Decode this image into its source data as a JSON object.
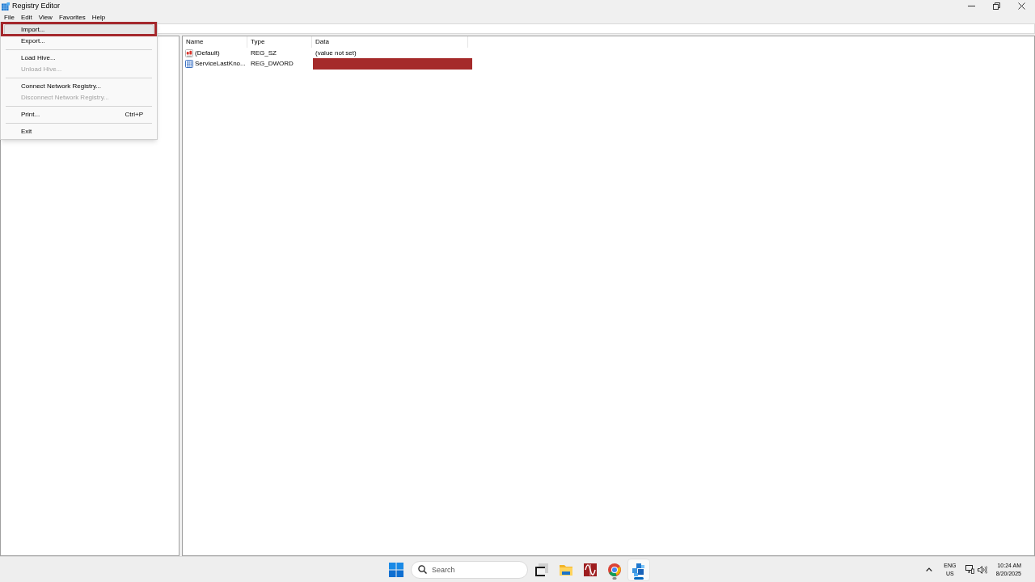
{
  "window": {
    "title": "Registry Editor"
  },
  "menu_bar": [
    "File",
    "Edit",
    "View",
    "Favorites",
    "Help"
  ],
  "file_menu": {
    "items": [
      {
        "kind": "item",
        "label": "Import...",
        "selected": true,
        "disabled": false,
        "annotated": true
      },
      {
        "kind": "item",
        "label": "Export...",
        "selected": false,
        "disabled": false,
        "annotated": false
      },
      {
        "kind": "separator"
      },
      {
        "kind": "item",
        "label": "Load Hive...",
        "selected": false,
        "disabled": false,
        "annotated": false
      },
      {
        "kind": "item",
        "label": "Unload Hive...",
        "selected": false,
        "disabled": true,
        "annotated": false
      },
      {
        "kind": "separator"
      },
      {
        "kind": "item",
        "label": "Connect Network Registry...",
        "selected": false,
        "disabled": false,
        "annotated": false
      },
      {
        "kind": "item",
        "label": "Disconnect Network Registry...",
        "selected": false,
        "disabled": true,
        "annotated": false
      },
      {
        "kind": "separator"
      },
      {
        "kind": "item",
        "label": "Print...",
        "shortcut": "Ctrl+P",
        "selected": false,
        "disabled": false,
        "annotated": false
      },
      {
        "kind": "separator"
      },
      {
        "kind": "item",
        "label": "Exit",
        "selected": false,
        "disabled": false,
        "annotated": false
      }
    ]
  },
  "values_table": {
    "columns": [
      "Name",
      "Type",
      "Data"
    ],
    "rows": [
      {
        "kind": "string",
        "name": "(Default)",
        "type": "REG_SZ",
        "data": "(value not set)",
        "redacted": false
      },
      {
        "kind": "dword",
        "name": "ServiceLastKno...",
        "type": "REG_DWORD",
        "redacted": true
      }
    ]
  },
  "taskbar": {
    "search": {
      "placeholder": "Search"
    },
    "apps": [
      {
        "kind": "taskview",
        "selected": false,
        "running": false
      },
      {
        "kind": "folder",
        "selected": false,
        "running": false
      },
      {
        "kind": "wave",
        "selected": false,
        "running": false
      },
      {
        "kind": "browser",
        "selected": false,
        "running": true
      },
      {
        "kind": "registry",
        "selected": true,
        "running": true
      }
    ],
    "tray": {
      "language": "ENG",
      "region": "US",
      "time": "10:24 AM",
      "date": "8/20/2025"
    }
  }
}
